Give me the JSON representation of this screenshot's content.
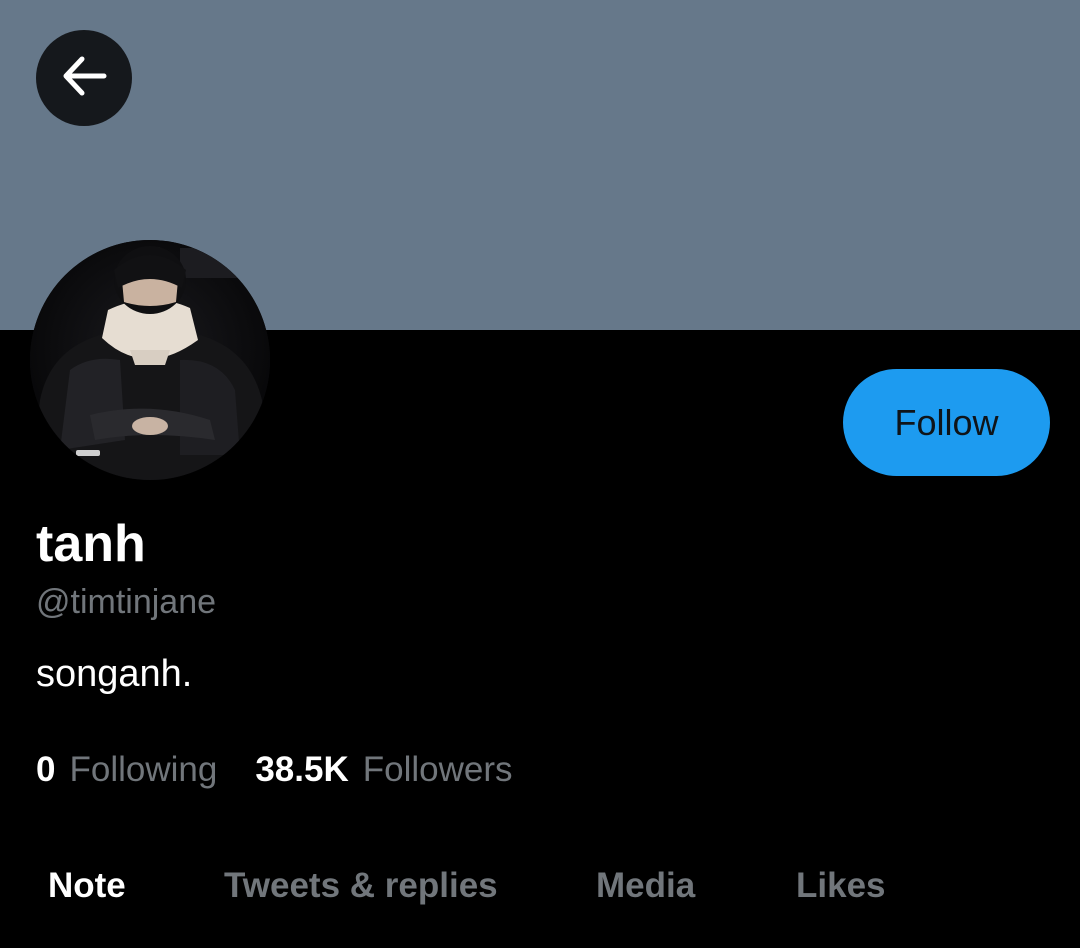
{
  "header": {
    "back_icon": "arrow-left-icon",
    "banner_color": "#66788a"
  },
  "profile": {
    "avatar_icon": "profile-photo",
    "display_name": "tanh",
    "handle": "@timtinjane",
    "bio": "songanh.",
    "follow_label": "Follow",
    "accent": "#1d9bf0"
  },
  "stats": {
    "following_count": "0",
    "following_label": "Following",
    "followers_count": "38.5K",
    "followers_label": "Followers"
  },
  "tabs": [
    {
      "label": "Note",
      "active": true
    },
    {
      "label": "Tweets & replies",
      "active": false
    },
    {
      "label": "Media",
      "active": false
    },
    {
      "label": "Likes",
      "active": false
    }
  ]
}
